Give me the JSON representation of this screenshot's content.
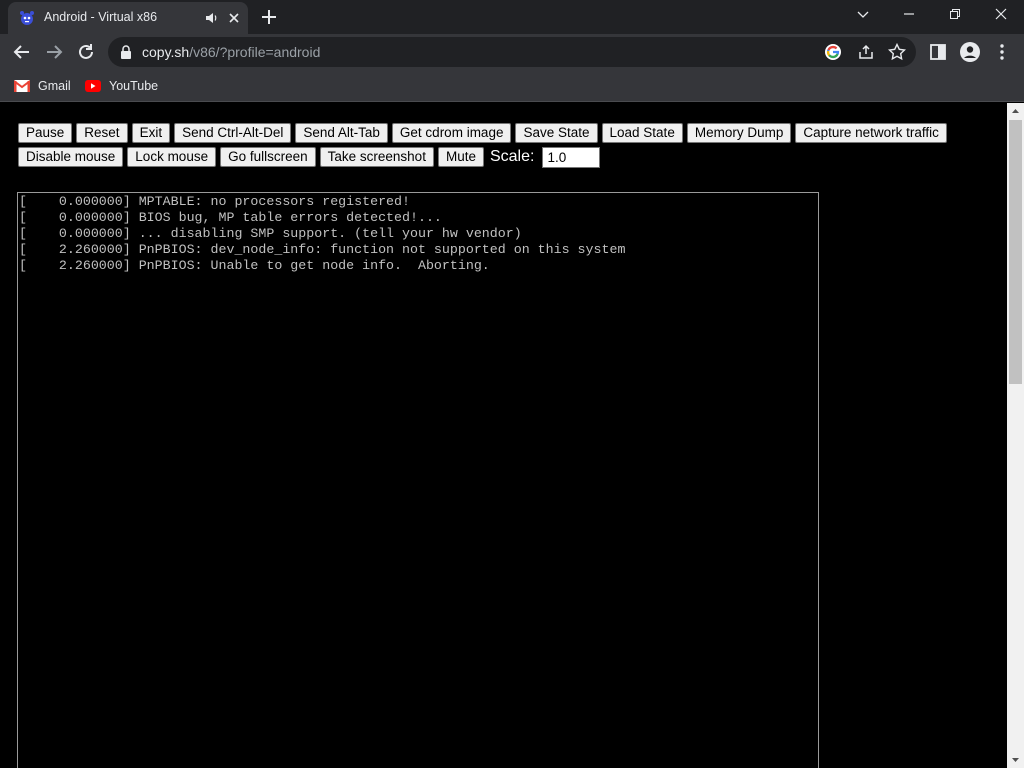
{
  "browser": {
    "tab": {
      "title": "Android - Virtual x86",
      "favicon": "v86-creature-icon",
      "audio_icon": "speaker-icon",
      "close_icon": "close-icon"
    },
    "new_tab_icon": "plus-icon",
    "window_controls": [
      "chevron-down-icon",
      "minimize-icon",
      "restore-icon",
      "close-icon"
    ],
    "nav": [
      "back-arrow-icon",
      "forward-arrow-icon",
      "reload-icon"
    ],
    "address": {
      "host": "copy.sh",
      "path": "/v86/?profile=android"
    },
    "omnibox_icons": [
      "google-lens-icon",
      "share-icon",
      "star-icon"
    ],
    "right_icons": [
      "side-panel-icon",
      "profile-icon",
      "kebab-menu-icon"
    ],
    "bookmarks": [
      {
        "label": "Gmail",
        "icon": "gmail-icon"
      },
      {
        "label": "YouTube",
        "icon": "youtube-icon"
      }
    ],
    "colors": {
      "titlebar": "#202124",
      "toolbar": "#35363a",
      "text": "#e8eaed",
      "youtube_red": "#ff0000",
      "gmail_red": "#ea4335"
    }
  },
  "controls": {
    "row1": [
      "Pause",
      "Reset",
      "Exit",
      "Send Ctrl-Alt-Del",
      "Send Alt-Tab",
      "Get cdrom image",
      "Save State",
      "Load State",
      "Memory Dump",
      "Capture network traffic"
    ],
    "row2": [
      "Disable mouse",
      "Lock mouse",
      "Go fullscreen",
      "Take screenshot",
      "Mute"
    ],
    "scale_label": "Scale:",
    "scale_value": "1.0"
  },
  "terminal": {
    "lines": [
      "[    0.000000] MPTABLE: no processors registered!",
      "[    0.000000] BIOS bug, MP table errors detected!...",
      "[    0.000000] ... disabling SMP support. (tell your hw vendor)",
      "[    2.260000] PnPBIOS: dev_node_info: function not supported on this system",
      "[    2.260000] PnPBIOS: Unable to get node info.  Aborting."
    ],
    "text_color": "#c0c0c0"
  }
}
